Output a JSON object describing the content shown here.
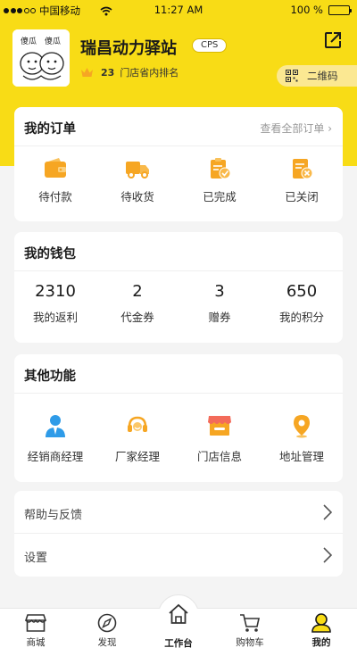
{
  "status_bar": {
    "carrier": "中国移动",
    "time": "11:27 AM",
    "battery": "100 %"
  },
  "profile": {
    "store_name": "瑞昌动力驿站",
    "badge": "CPS",
    "rank_number": "23",
    "rank_text": "门店省内排名",
    "qr_label": "二维码"
  },
  "orders": {
    "title": "我的订单",
    "view_all": "查看全部订单 ›",
    "items": [
      {
        "label": "待付款",
        "icon": "wallet-icon"
      },
      {
        "label": "待收货",
        "icon": "truck-icon"
      },
      {
        "label": "已完成",
        "icon": "completed-clipboard-icon"
      },
      {
        "label": "已关闭",
        "icon": "closed-document-icon"
      }
    ]
  },
  "wallet": {
    "title": "我的钱包",
    "items": [
      {
        "value": "2310",
        "label": "我的返利"
      },
      {
        "value": "2",
        "label": "代金券"
      },
      {
        "value": "3",
        "label": "赠券"
      },
      {
        "value": "650",
        "label": "我的积分"
      }
    ]
  },
  "functions": {
    "title": "其他功能",
    "items": [
      {
        "label": "经销商经理",
        "icon": "dealer-manager-icon"
      },
      {
        "label": "厂家经理",
        "icon": "headset-icon"
      },
      {
        "label": "门店信息",
        "icon": "store-icon"
      },
      {
        "label": "地址管理",
        "icon": "location-pin-icon"
      }
    ]
  },
  "settings_list": [
    {
      "label": "帮助与反馈"
    },
    {
      "label": "设置"
    }
  ],
  "tabbar": [
    {
      "label": "商城",
      "icon": "shop-icon"
    },
    {
      "label": "发现",
      "icon": "compass-icon"
    },
    {
      "label": "工作台",
      "icon": "home-icon"
    },
    {
      "label": "购物车",
      "icon": "cart-icon"
    },
    {
      "label": "我的",
      "icon": "user-icon"
    }
  ],
  "colors": {
    "brand_yellow": "#f8dc16",
    "icon_orange": "#f6a623",
    "icon_blue": "#2e9be8",
    "icon_red": "#f36b5a"
  }
}
